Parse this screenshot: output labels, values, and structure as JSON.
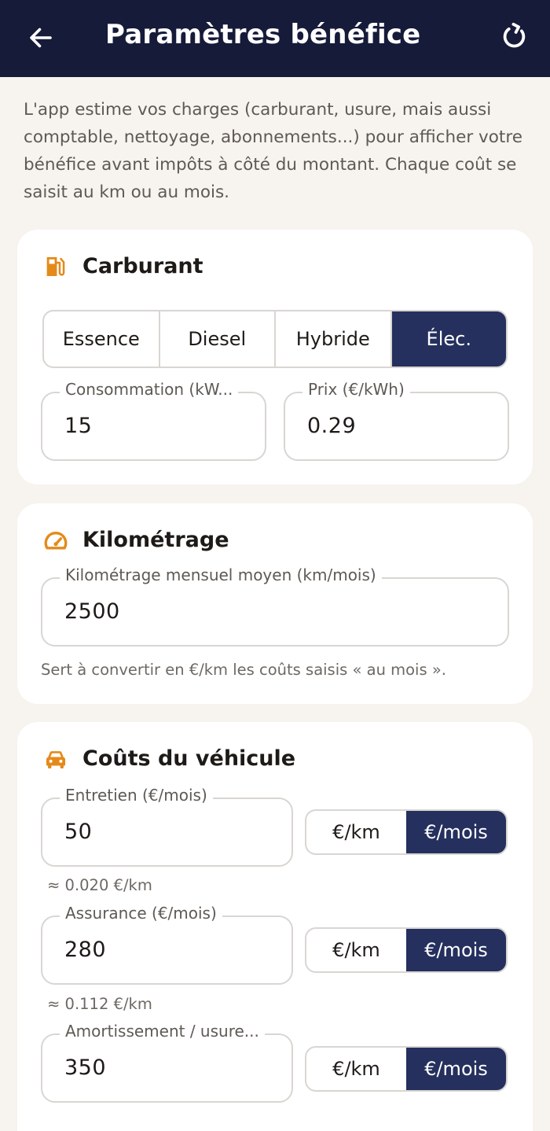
{
  "header": {
    "title": "Paramètres bénéfice"
  },
  "intro": "L'app estime vos charges (carburant, usure, mais aussi comptable, nettoyage, abonnements...) pour afficher votre bénéfice avant impôts à côté du montant. Chaque coût se saisit au km ou au mois.",
  "fuel": {
    "title": "Carburant",
    "options": [
      "Essence",
      "Diesel",
      "Hybride",
      "Élec."
    ],
    "selected": "Élec.",
    "consumption": {
      "label": "Consommation (kW...",
      "value": "15"
    },
    "price": {
      "label": "Prix (€/kWh)",
      "value": "0.29"
    }
  },
  "mileage": {
    "title": "Kilométrage",
    "field": {
      "label": "Kilométrage mensuel moyen (km/mois)",
      "value": "2500"
    },
    "helper": "Sert à convertir en €/km les coûts saisis « au mois »."
  },
  "vehicle": {
    "title": "Coûts du véhicule",
    "unit_km": "€/km",
    "unit_month": "€/mois",
    "items": [
      {
        "label": "Entretien (€/mois)",
        "value": "50",
        "unit": "€/mois",
        "approx": "≈ 0.020 €/km"
      },
      {
        "label": "Assurance (€/mois)",
        "value": "280",
        "unit": "€/mois",
        "approx": "≈ 0.112 €/km"
      },
      {
        "label": "Amortissement / usure...",
        "value": "350",
        "unit": "€/mois"
      }
    ]
  },
  "colors": {
    "appbar": "#161b3a",
    "accent": "#25305e",
    "icon": "#e48a1a",
    "background": "#f7f3ee"
  },
  "icons": {
    "back": "arrow-left-icon",
    "reset": "refresh-icon",
    "fuel": "fuel-pump-icon",
    "mileage": "speedometer-icon",
    "vehicle": "car-icon"
  }
}
